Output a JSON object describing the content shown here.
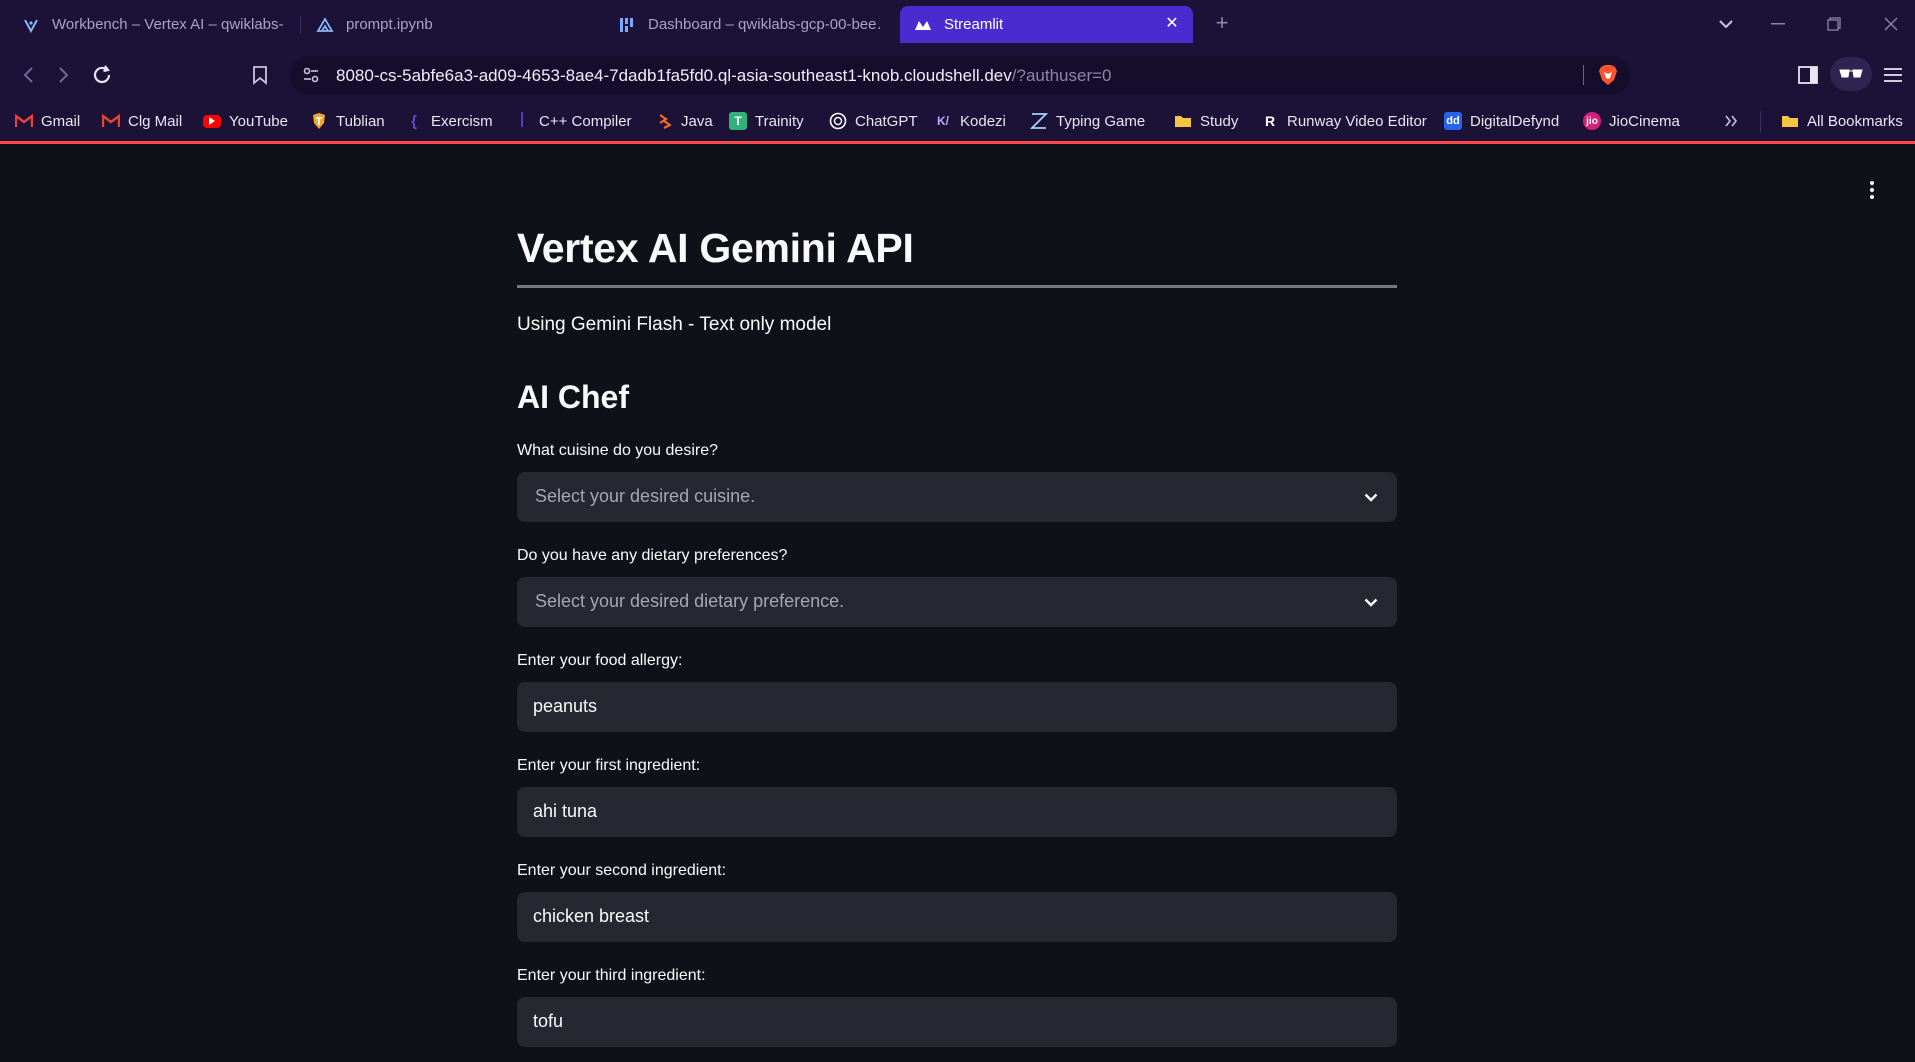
{
  "browser": {
    "tabs": [
      {
        "label": "Workbench – Vertex AI – qwiklabs-g",
        "icon": "vertex-ai-icon",
        "active": false
      },
      {
        "label": "prompt.ipynb",
        "icon": "jupyter-icon",
        "active": false
      },
      {
        "label": "Dashboard – qwiklabs-gcp-00-bee…",
        "icon": "dashboard-icon",
        "active": false
      },
      {
        "label": "Streamlit",
        "icon": "streamlit-icon",
        "active": true
      }
    ],
    "url_host": "8080-cs-5abfe6a3-ad09-4653-8ae4-7dadb1fa5fd0.ql-asia-southeast1-knob.cloudshell.dev",
    "url_rest": "/?authuser=0",
    "bookmarks": [
      {
        "label": "Gmail",
        "icon": "gmail-icon",
        "color": "#ea4335"
      },
      {
        "label": "Clg Mail",
        "icon": "gmail-icon",
        "color": "#ea4335"
      },
      {
        "label": "YouTube",
        "icon": "youtube-icon",
        "color": "#ff0000"
      },
      {
        "label": "Tublian",
        "icon": "tublian-icon",
        "color": "#f5a524"
      },
      {
        "label": "Exercism",
        "icon": "exercism-icon",
        "color": "#604fcd"
      },
      {
        "label": "C++ Compiler",
        "icon": "compiler-icon",
        "color": "#6a5cff"
      },
      {
        "label": "Java",
        "icon": "java-icon",
        "color": "#f26b21"
      },
      {
        "label": "Trainity",
        "icon": "trainity-icon",
        "color": "#2fb37a"
      },
      {
        "label": "ChatGPT",
        "icon": "chatgpt-icon",
        "color": "#ffffff"
      },
      {
        "label": "Kodezi",
        "icon": "kodezi-icon",
        "color": "#b9a8ff"
      },
      {
        "label": "Typing Game",
        "icon": "typing-game-icon",
        "color": "#9fd3ff"
      },
      {
        "label": "Study",
        "icon": "folder-icon",
        "color": "#f4c542"
      },
      {
        "label": "Runway Video Editor",
        "icon": "runway-icon",
        "color": "#ffffff"
      },
      {
        "label": "DigitalDefynd",
        "icon": "digitaldefynd-icon",
        "color": "#2563eb"
      },
      {
        "label": "JioCinema",
        "icon": "jiocinema-icon",
        "color": "#d4207a"
      }
    ],
    "more_bookmarks_icon": "double-chevron-icon",
    "all_bookmarks": "All Bookmarks"
  },
  "app": {
    "title": "Vertex AI Gemini API",
    "subtitle": "Using Gemini Flash - Text only model",
    "section": "AI Chef",
    "cuisine_label": "What cuisine do you desire?",
    "cuisine_placeholder": "Select your desired cuisine.",
    "dietary_label": "Do you have any dietary preferences?",
    "dietary_placeholder": "Select your desired dietary preference.",
    "allergy_label": "Enter your food allergy:",
    "allergy_value": "peanuts",
    "ingredient1_label": "Enter your first ingredient:",
    "ingredient1_value": "ahi tuna",
    "ingredient2_label": "Enter your second ingredient:",
    "ingredient2_value": "chicken breast",
    "ingredient3_label": "Enter your third ingredient:",
    "ingredient3_value": "tofu"
  },
  "colors": {
    "background": "#0e1117",
    "widget": "#262730",
    "chrome": "#1c1136",
    "active_tab": "#4a2bd0",
    "loading_bar": "#ff4a4a"
  }
}
